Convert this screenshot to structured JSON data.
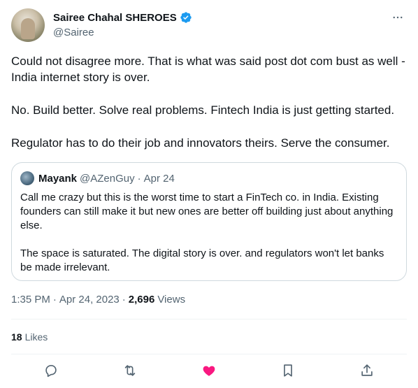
{
  "author": {
    "display_name": "Sairee Chahal SHEROES",
    "handle": "@Sairee"
  },
  "tweet": {
    "paragraphs": [
      "Could not disagree more. That is what was said post dot com bust as well - India internet story is over.",
      "No. Build better. Solve real problems. Fintech India is just getting started.",
      "Regulator has to do their job and innovators theirs. Serve the consumer."
    ]
  },
  "quote": {
    "name": "Mayank",
    "handle": "@AZenGuy",
    "separator": "·",
    "date": "Apr 24",
    "paragraphs": [
      "Call me crazy but this is the worst time to start a FinTech co. in India. Existing founders can still make it but new ones are better off building just about anything else.",
      "The space is saturated. The digital story is over. and regulators won't let banks be made irrelevant."
    ]
  },
  "meta": {
    "time": "1:35 PM",
    "separator": "·",
    "date": "Apr 24, 2023",
    "views_count": "2,696",
    "views_label": "Views"
  },
  "likes": {
    "count": "18",
    "label": "Likes"
  },
  "colors": {
    "like_active": "#f91880",
    "verified": "#1d9bf0",
    "muted": "#536471"
  },
  "icons": {
    "more": "more-icon",
    "reply": "reply-icon",
    "retweet": "retweet-icon",
    "like": "heart-icon",
    "bookmark": "bookmark-icon",
    "share": "share-icon"
  }
}
